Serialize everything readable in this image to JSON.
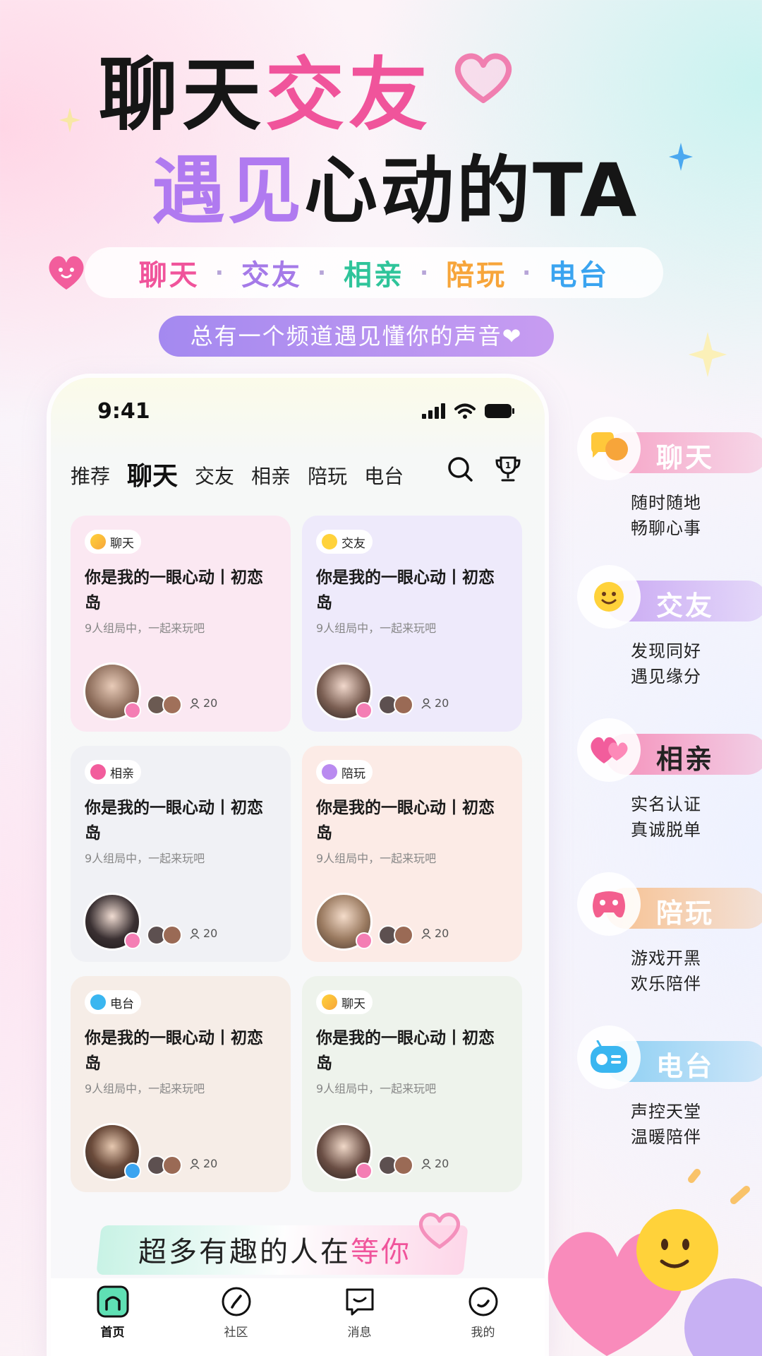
{
  "hero": {
    "line1_dark": "聊天",
    "line1_pink": "交友",
    "line2_purple": "遇见",
    "line2_dark": "心动的TA"
  },
  "category_strip": [
    {
      "label": "聊天",
      "color": "#f0549b"
    },
    {
      "label": "交友",
      "color": "#a57ae8"
    },
    {
      "label": "相亲",
      "color": "#2fc49a"
    },
    {
      "label": "陪玩",
      "color": "#f7a53a"
    },
    {
      "label": "电台",
      "color": "#3aa4f0"
    }
  ],
  "category_separator": "·",
  "tagline": "总有一个频道遇见懂你的声音❤",
  "phone": {
    "time": "9:41",
    "tabs": [
      "推荐",
      "聊天",
      "交友",
      "相亲",
      "陪玩",
      "电台"
    ],
    "active_tab": "聊天",
    "cards": [
      {
        "tag": "聊天",
        "title": "你是我的一眼心动丨初恋岛",
        "sub": "9人组局中，一起来玩吧",
        "count": "20"
      },
      {
        "tag": "交友",
        "title": "你是我的一眼心动丨初恋岛",
        "sub": "9人组局中，一起来玩吧",
        "count": "20"
      },
      {
        "tag": "相亲",
        "title": "你是我的一眼心动丨初恋岛",
        "sub": "9人组局中，一起来玩吧",
        "count": "20"
      },
      {
        "tag": "陪玩",
        "title": "你是我的一眼心动丨初恋岛",
        "sub": "9人组局中，一起来玩吧",
        "count": "20"
      },
      {
        "tag": "电台",
        "title": "你是我的一眼心动丨初恋岛",
        "sub": "9人组局中，一起来玩吧",
        "count": "20"
      },
      {
        "tag": "聊天",
        "title": "你是我的一眼心动丨初恋岛",
        "sub": "9人组局中，一起来玩吧",
        "count": "20"
      }
    ],
    "banner": {
      "text_dark": "超多有趣的人在",
      "text_pink": "等你"
    },
    "nav": [
      {
        "label": "首页",
        "icon": "home-icon"
      },
      {
        "label": "社区",
        "icon": "compass-icon"
      },
      {
        "label": "消息",
        "icon": "message-icon"
      },
      {
        "label": "我的",
        "icon": "profile-icon"
      }
    ]
  },
  "features": [
    {
      "title": "聊天",
      "line1": "随时随地",
      "line2": "畅聊心事",
      "color": "#f6a3c6",
      "icon": "chat-bubbles-icon"
    },
    {
      "title": "交友",
      "line1": "发现同好",
      "line2": "遇见缘分",
      "color": "#c9a8f3",
      "icon": "smiley-icon"
    },
    {
      "title": "相亲",
      "line1": "实名认证",
      "line2": "真诚脱单",
      "color": "#f58fba",
      "icon": "hearts-icon"
    },
    {
      "title": "陪玩",
      "line1": "游戏开黑",
      "line2": "欢乐陪伴",
      "color": "#f7c191",
      "icon": "gamepad-icon"
    },
    {
      "title": "电台",
      "line1": "声控天堂",
      "line2": "温暖陪伴",
      "color": "#8ccff3",
      "icon": "radio-icon"
    }
  ]
}
